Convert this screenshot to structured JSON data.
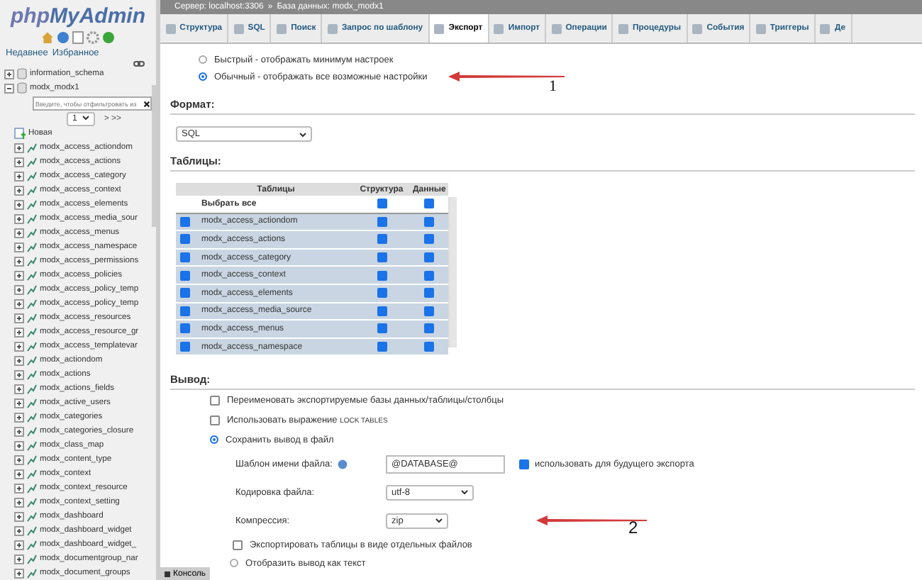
{
  "sidebar": {
    "logo": {
      "prefix": "php",
      "name": "MyAdmin"
    },
    "links": [
      {
        "label": "Недавнее"
      },
      {
        "label": "Избранное"
      }
    ],
    "tree": [
      {
        "label": "information_schema",
        "expanded": false
      },
      {
        "label": "modx_modx1",
        "expanded": true,
        "filter": {
          "placeholder": "Введите, чтобы отфильтровать из"
        },
        "pager": {
          "page": "1",
          "next": "> >>"
        },
        "children": [
          {
            "label": "Новая",
            "kind": "new"
          },
          {
            "label": "modx_access_actiondom",
            "kind": "table"
          },
          {
            "label": "modx_access_actions",
            "kind": "table"
          },
          {
            "label": "modx_access_category",
            "kind": "table"
          },
          {
            "label": "modx_access_context",
            "kind": "table"
          },
          {
            "label": "modx_access_elements",
            "kind": "table"
          },
          {
            "label": "modx_access_media_sour",
            "kind": "table"
          },
          {
            "label": "modx_access_menus",
            "kind": "table"
          },
          {
            "label": "modx_access_namespace",
            "kind": "table"
          },
          {
            "label": "modx_access_permissions",
            "kind": "table"
          },
          {
            "label": "modx_access_policies",
            "kind": "table"
          },
          {
            "label": "modx_access_policy_temp",
            "kind": "table"
          },
          {
            "label": "modx_access_policy_temp",
            "kind": "table"
          },
          {
            "label": "modx_access_resources",
            "kind": "table"
          },
          {
            "label": "modx_access_resource_gr",
            "kind": "table"
          },
          {
            "label": "modx_access_templatevar",
            "kind": "table"
          },
          {
            "label": "modx_actiondom",
            "kind": "table"
          },
          {
            "label": "modx_actions",
            "kind": "table"
          },
          {
            "label": "modx_actions_fields",
            "kind": "table"
          },
          {
            "label": "modx_active_users",
            "kind": "table"
          },
          {
            "label": "modx_categories",
            "kind": "table"
          },
          {
            "label": "modx_categories_closure",
            "kind": "table"
          },
          {
            "label": "modx_class_map",
            "kind": "table"
          },
          {
            "label": "modx_content_type",
            "kind": "table"
          },
          {
            "label": "modx_context",
            "kind": "table"
          },
          {
            "label": "modx_context_resource",
            "kind": "table"
          },
          {
            "label": "modx_context_setting",
            "kind": "table"
          },
          {
            "label": "modx_dashboard",
            "kind": "table"
          },
          {
            "label": "modx_dashboard_widget",
            "kind": "table"
          },
          {
            "label": "modx_dashboard_widget_",
            "kind": "table"
          },
          {
            "label": "modx_documentgroup_nar",
            "kind": "table"
          },
          {
            "label": "modx_document_groups",
            "kind": "table"
          }
        ]
      }
    ]
  },
  "breadcrumb": [
    {
      "label": "Сервер: localhost:3306"
    },
    {
      "label": "База данных: modx_modx1"
    }
  ],
  "breadcrumb_separator": "»",
  "tabs": [
    {
      "label": "Структура",
      "selected": false
    },
    {
      "label": "SQL",
      "selected": false
    },
    {
      "label": "Поиск",
      "selected": false
    },
    {
      "label": "Запрос по шаблону",
      "selected": false
    },
    {
      "label": "Экспорт",
      "selected": true
    },
    {
      "label": "Импорт",
      "selected": false
    },
    {
      "label": "Операции",
      "selected": false
    },
    {
      "label": "Процедуры",
      "selected": false
    },
    {
      "label": "События",
      "selected": false
    },
    {
      "label": "Триггеры",
      "selected": false
    },
    {
      "label": "Де",
      "selected": false
    }
  ],
  "export_method": [
    {
      "label": "Быстрый - отображать минимум настроек",
      "selected": false
    },
    {
      "label": "Обычный - отображать все возможные настройки",
      "selected": true
    }
  ],
  "format": {
    "heading": "Формат:",
    "value": "SQL"
  },
  "tables": {
    "heading": "Таблицы:",
    "columns": [
      "Таблицы",
      "Структура",
      "Данные"
    ],
    "select_all": {
      "label": "Выбрать все",
      "structure": true,
      "data": true
    },
    "rows": [
      {
        "name": "modx_access_actiondom",
        "checked": true,
        "structure": true,
        "data": true
      },
      {
        "name": "modx_access_actions",
        "checked": true,
        "structure": true,
        "data": true
      },
      {
        "name": "modx_access_category",
        "checked": true,
        "structure": true,
        "data": true
      },
      {
        "name": "modx_access_context",
        "checked": true,
        "structure": true,
        "data": true
      },
      {
        "name": "modx_access_elements",
        "checked": true,
        "structure": true,
        "data": true
      },
      {
        "name": "modx_access_media_source",
        "checked": true,
        "structure": true,
        "data": true
      },
      {
        "name": "modx_access_menus",
        "checked": true,
        "structure": true,
        "data": true
      },
      {
        "name": "modx_access_namespace",
        "checked": true,
        "structure": true,
        "data": true
      }
    ]
  },
  "output": {
    "heading": "Вывод:",
    "rename": {
      "label": "Переименовать экспортируемые базы данных/таблицы/столбцы",
      "checked": false
    },
    "lock": {
      "label": "Использовать выражение",
      "code": "LOCK TABLES",
      "checked": false
    },
    "save_to_file": {
      "label": "Сохранить вывод в файл",
      "selected": true
    },
    "filename": {
      "label": "Шаблон имени файла:",
      "value": "@DATABASE@",
      "remember": {
        "label": "использовать для будущего экспорта",
        "checked": true
      }
    },
    "charset": {
      "label": "Кодировка файла:",
      "value": "utf-8"
    },
    "compression": {
      "label": "Компрессия:",
      "value": "zip"
    },
    "separate": {
      "label": "Экспортировать таблицы в виде отдельных файлов",
      "checked": false
    },
    "as_text": {
      "label": "Отобразить вывод как текст",
      "selected": false
    }
  },
  "console": {
    "label": "Консоль"
  },
  "annotations": [
    {
      "label": "1"
    },
    {
      "label": "2"
    }
  ]
}
